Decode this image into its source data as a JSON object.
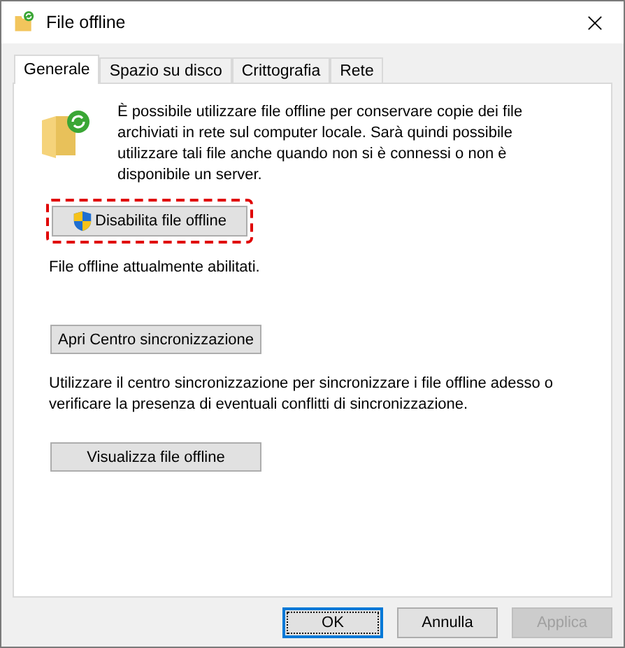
{
  "window": {
    "title": "File offline"
  },
  "tabs": [
    {
      "label": "Generale",
      "selected": true
    },
    {
      "label": "Spazio su disco",
      "selected": false
    },
    {
      "label": "Crittografia",
      "selected": false
    },
    {
      "label": "Rete",
      "selected": false
    }
  ],
  "panel": {
    "intro": "È possibile utilizzare file offline per conservare copie dei file archiviati in rete sul computer locale. Sarà quindi possibile utilizzare tali file anche quando non si è connessi o non è disponibile un server.",
    "disable_button": {
      "label": "Disabilita file offline",
      "highlighted": true
    },
    "status": "File offline attualmente abilitati.",
    "sync_button": {
      "label": "Apri Centro sincronizzazione"
    },
    "sync_text": "Utilizzare il centro sincronizzazione per sincronizzare i file offline adesso o verificare la presenza di eventuali conflitti di sincronizzazione.",
    "view_button": {
      "label": "Visualizza file offline"
    }
  },
  "buttons": [
    {
      "label": "OK",
      "focused": true,
      "disabled": false
    },
    {
      "label": "Annulla",
      "focused": false,
      "disabled": false
    },
    {
      "label": "Applica",
      "focused": false,
      "disabled": true
    }
  ]
}
